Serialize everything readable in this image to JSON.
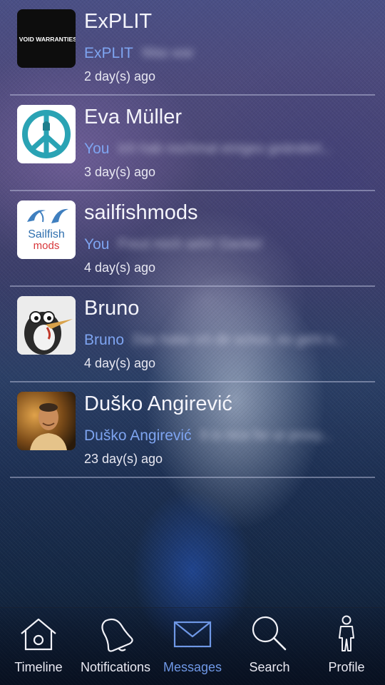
{
  "conversations": [
    {
      "name": "ExPLIT",
      "sender": "ExPLIT",
      "preview": "Was war",
      "time": "2 day(s) ago",
      "avatar_icon": "void-warranties-logo",
      "avatar_text": "I VOID WARRANTIES"
    },
    {
      "name": "Eva Müller",
      "sender": "You",
      "preview": "Ich hab nochmal einiges geändert...",
      "time": "3 day(s) ago",
      "avatar_icon": "peace-sign-logo"
    },
    {
      "name": "sailfishmods",
      "sender": "You",
      "preview": "Freut mich sehr! Danke!",
      "time": "4 day(s) ago",
      "avatar_icon": "sailfishmods-logo",
      "avatar_line1": "Sailfish",
      "avatar_line2": "mods"
    },
    {
      "name": "Bruno",
      "sender": "Bruno",
      "preview": "Das habe ich dir schon, es geht n...",
      "time": "4 day(s) ago",
      "avatar_icon": "penguin-avatar"
    },
    {
      "name": "Duško Angirević",
      "sender": "Duško Angirević",
      "preview": "It is nice for ur proxy...",
      "time": "23 day(s) ago",
      "avatar_icon": "person-photo"
    }
  ],
  "nav": [
    {
      "label": "Timeline",
      "icon": "home-icon",
      "active": false
    },
    {
      "label": "Notifications",
      "icon": "bell-icon",
      "active": false
    },
    {
      "label": "Messages",
      "icon": "envelope-icon",
      "active": true
    },
    {
      "label": "Search",
      "icon": "search-icon",
      "active": false
    },
    {
      "label": "Profile",
      "icon": "person-icon",
      "active": false
    }
  ],
  "colors": {
    "accent": "#7ea4f0",
    "active_nav": "#6f98e6",
    "text": "#f4f4fb"
  }
}
